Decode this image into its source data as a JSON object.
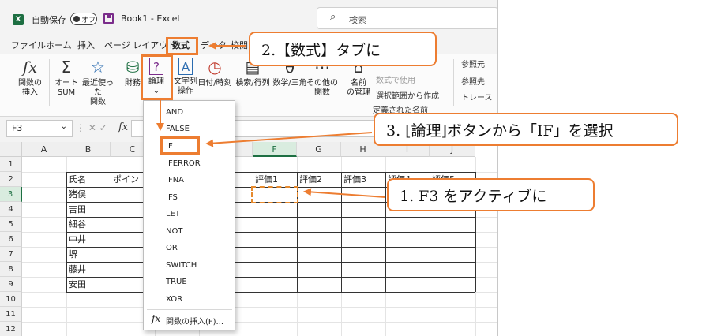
{
  "titlebar": {
    "app_icon": "excel-logo",
    "autosave_label": "自動保存",
    "toggle_label": "オフ",
    "doc_title": "Book1  -  Excel",
    "search_placeholder": "検索"
  },
  "menubar": {
    "items": [
      "ファイル",
      "ホーム",
      "挿入",
      "ページ レイアウト",
      "数式",
      "データ",
      "校閲"
    ]
  },
  "ribbon": {
    "insert_function": [
      "関数の",
      "挿入"
    ],
    "autosum": [
      "オート",
      "SUM"
    ],
    "recent": [
      "最近使った",
      "関数"
    ],
    "financial": "財務",
    "logical": "論理",
    "text": [
      "文字列",
      "操作"
    ],
    "datetime": "日付/時刻",
    "lookup": "検索/行列",
    "math": "数学/三角",
    "more": [
      "その他の",
      "関数"
    ],
    "name_manager": [
      "名前",
      "の管理"
    ],
    "use_in_formula": "数式で使用",
    "create_from_selection": "選択範囲から作成",
    "defined_names": "定義された名前",
    "trace_precedents": "参照元",
    "trace_dependents": "参照先",
    "remove_arrows": "トレース"
  },
  "formula_bar": {
    "name_box": "F3",
    "fx": "fx"
  },
  "sheet": {
    "columns": [
      "A",
      "B",
      "C",
      "D",
      "E",
      "F",
      "G",
      "H",
      "I",
      "J"
    ],
    "rows": [
      "1",
      "2",
      "3",
      "4",
      "5",
      "6",
      "7",
      "8",
      "9",
      "10",
      "11",
      "12"
    ],
    "headers": {
      "B2": "氏名",
      "C2": "ポイン",
      "F2": "評価1",
      "G2": "評価2",
      "H2": "評価3",
      "I2": "評価4",
      "J2": "評価5"
    },
    "names": [
      "猪俣",
      "吉田",
      "細谷",
      "中井",
      "堺",
      "藤井",
      "安田"
    ],
    "c7_partial": "1,"
  },
  "dropdown": {
    "items": [
      "AND",
      "FALSE",
      "IF",
      "IFERROR",
      "IFNA",
      "IFS",
      "LET",
      "NOT",
      "OR",
      "SWITCH",
      "TRUE",
      "XOR"
    ],
    "footer": "関数の挿入(F)..."
  },
  "callouts": {
    "step1": "1. F3 をアクティブに",
    "step2": "2.【数式】タブに",
    "step3": "3. [論理]ボタンから「IF」を選択"
  },
  "colors": {
    "accent": "#ed7d31",
    "excel_green": "#1d6f42"
  }
}
